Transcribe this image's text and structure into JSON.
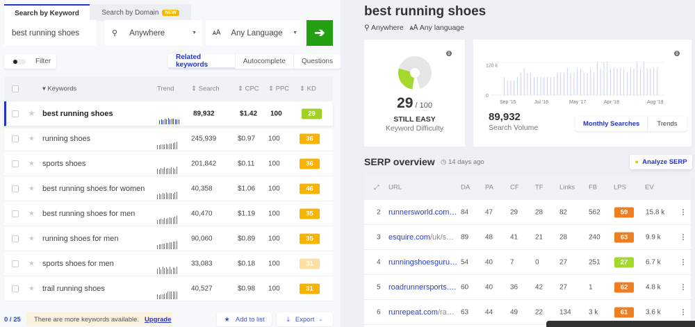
{
  "search": {
    "tab_keyword": "Search by Keyword",
    "tab_domain": "Search by Domain",
    "new_badge": "NEW",
    "query": "best running shoes",
    "location": "Anywhere",
    "language": "Any Language",
    "go_icon": "arrow-right"
  },
  "filter": {
    "label": "Filter"
  },
  "modes": [
    "Related keywords",
    "Autocomplete",
    "Questions"
  ],
  "table": {
    "headers": {
      "keywords": "Keywords",
      "trend": "Trend",
      "search": "Search",
      "cpc": "CPC",
      "ppc": "PPC",
      "kd": "KD"
    },
    "rows": [
      {
        "kw": "best running shoes",
        "search": "89,932",
        "cpc": "$1.42",
        "ppc": "100",
        "kd": "29",
        "color": "#9fd225",
        "trend": [
          6,
          7,
          6,
          8,
          7,
          9,
          7,
          8,
          8,
          7,
          7,
          7
        ]
      },
      {
        "kw": "running shoes",
        "search": "245,939",
        "cpc": "$0.97",
        "ppc": "100",
        "kd": "36",
        "color": "#f8b400",
        "trend": [
          6,
          6,
          7,
          7,
          7,
          8,
          7,
          8,
          8,
          9,
          10,
          11
        ]
      },
      {
        "kw": "sports shoes",
        "search": "201,842",
        "cpc": "$0.11",
        "ppc": "100",
        "kd": "36",
        "color": "#f8b400",
        "trend": [
          8,
          7,
          9,
          8,
          10,
          8,
          9,
          8,
          10,
          9,
          8,
          11
        ]
      },
      {
        "kw": "best running shoes for women",
        "search": "40,358",
        "cpc": "$1.06",
        "ppc": "100",
        "kd": "46",
        "color": "#f8b400",
        "trend": [
          7,
          8,
          7,
          9,
          8,
          10,
          8,
          9,
          9,
          8,
          10,
          11
        ]
      },
      {
        "kw": "best running shoes for men",
        "search": "40,470",
        "cpc": "$1.19",
        "ppc": "100",
        "kd": "35",
        "color": "#f8b400",
        "trend": [
          6,
          7,
          8,
          7,
          9,
          8,
          9,
          10,
          9,
          10,
          11,
          12
        ]
      },
      {
        "kw": "running shoes for men",
        "search": "90,060",
        "cpc": "$0.89",
        "ppc": "100",
        "kd": "35",
        "color": "#f8b400",
        "trend": [
          6,
          7,
          7,
          8,
          8,
          9,
          9,
          10,
          10,
          11,
          11,
          12
        ]
      },
      {
        "kw": "sports shoes for men",
        "search": "33,083",
        "cpc": "$0.18",
        "ppc": "100",
        "kd": "31",
        "color": "#fbe0a0",
        "trend": [
          8,
          10,
          7,
          11,
          9,
          10,
          8,
          11,
          7,
          10,
          9,
          11
        ]
      },
      {
        "kw": "trail running shoes",
        "search": "40,527",
        "cpc": "$0.98",
        "ppc": "100",
        "kd": "31",
        "color": "#f8b400",
        "trend": [
          7,
          6,
          7,
          7,
          8,
          9,
          11,
          11,
          11,
          11,
          11,
          11
        ]
      }
    ]
  },
  "footer": {
    "count": "0 / 25",
    "notice": "There are more keywords available.",
    "upgrade": "Upgrade",
    "add_to_list": "Add to list",
    "export": "Export"
  },
  "overview": {
    "title": "best running shoes",
    "location": "Anywhere",
    "language": "Any language"
  },
  "difficulty": {
    "value": 29,
    "score": "29",
    "max": "/ 100",
    "verdict": "STILL EASY",
    "label": "Keyword Difficulty",
    "color": "#a4d82a"
  },
  "volume": {
    "value": "89,932",
    "label": "Search Volume",
    "toggle": [
      "Monthly Searches",
      "Trends"
    ]
  },
  "chart_data": {
    "type": "bar",
    "title": "Search Volume",
    "ylim": [
      0,
      130000
    ],
    "y_ticks": [
      "0",
      "120 k"
    ],
    "x_ticks": [
      "Sep '15",
      "Jul '16",
      "May '17",
      "Apr '18",
      "Aug '19"
    ],
    "values": [
      72000,
      59000,
      59000,
      59000,
      72000,
      89000,
      107000,
      89000,
      89000,
      72000,
      72000,
      72000,
      72000,
      72000,
      72000,
      72000,
      89000,
      89000,
      89000,
      107000,
      89000,
      89000,
      107000,
      107000,
      89000,
      89000,
      107000,
      89000,
      133000,
      107000,
      133000,
      133000,
      107000,
      107000,
      107000,
      107000,
      107000,
      89000,
      107000,
      107000,
      133000,
      107000,
      133000,
      107000,
      107000,
      107000,
      107000
    ]
  },
  "serp": {
    "title": "SERP overview",
    "age": "14 days ago",
    "analyze": "Analyze SERP",
    "headers": [
      "URL",
      "DA",
      "PA",
      "CF",
      "TF",
      "Links",
      "FB",
      "LPS",
      "EV"
    ],
    "rows": [
      {
        "n": "2",
        "domain": "runnersworld.com…",
        "path": "",
        "da": "84",
        "pa": "47",
        "cf": "29",
        "tf": "28",
        "links": "82",
        "fb": "562",
        "lps": "59",
        "lps_color": "#ef7d22",
        "ev": "15.8 k"
      },
      {
        "n": "3",
        "domain": "esquire.com",
        "path": "/uk/s…",
        "da": "89",
        "pa": "48",
        "cf": "41",
        "tf": "21",
        "links": "28",
        "fb": "240",
        "lps": "63",
        "lps_color": "#ef7d22",
        "ev": "9.9 k"
      },
      {
        "n": "4",
        "domain": "runningshoesguru…",
        "path": "",
        "da": "54",
        "pa": "40",
        "cf": "7",
        "tf": "0",
        "links": "27",
        "fb": "251",
        "lps": "27",
        "lps_color": "#a4d82a",
        "ev": "6.7 k"
      },
      {
        "n": "5",
        "domain": "roadrunnersports.…",
        "path": "",
        "da": "60",
        "pa": "40",
        "cf": "36",
        "tf": "42",
        "links": "27",
        "fb": "1",
        "lps": "62",
        "lps_color": "#ef7d22",
        "ev": "4.8 k"
      },
      {
        "n": "6",
        "domain": "runrepeat.com",
        "path": "/ra…",
        "da": "63",
        "pa": "44",
        "cf": "49",
        "tf": "22",
        "links": "134",
        "fb": "3 k",
        "lps": "61",
        "lps_color": "#ef7d22",
        "ev": "3.6 k"
      }
    ]
  }
}
